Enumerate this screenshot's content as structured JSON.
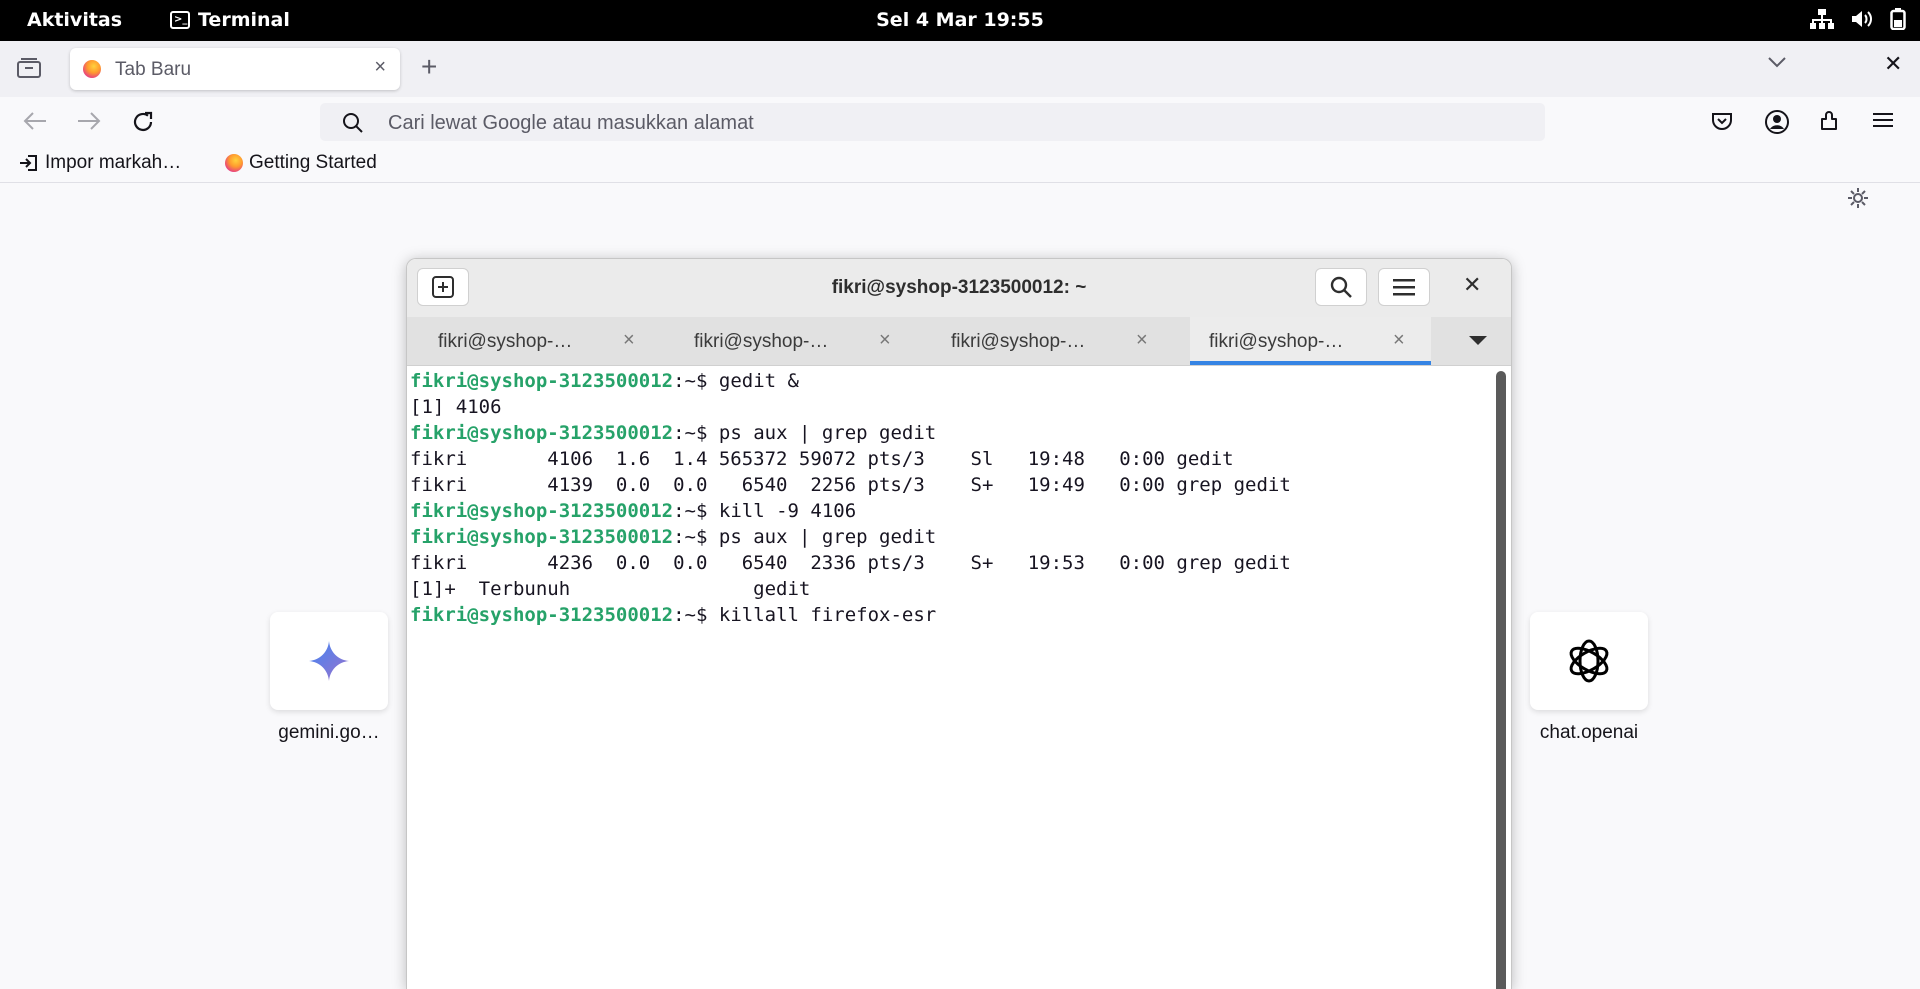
{
  "topbar": {
    "activities": "Aktivitas",
    "app_name": "Terminal",
    "clock": "Sel  4 Mar 19:55"
  },
  "browser": {
    "tab": {
      "title": "Tab Baru"
    },
    "search_placeholder": "Cari lewat Google atau masukkan alamat",
    "bookmarks": [
      "Impor markah…",
      "Getting Started"
    ],
    "shortcuts": [
      {
        "label": "gemini.go…",
        "icon": "gemini-sparkle-icon",
        "color": "#4285f4"
      },
      {
        "label": "chat.openai",
        "icon": "openai-logo-icon",
        "color": "#000000"
      }
    ]
  },
  "terminal": {
    "title": "fikri@syshop-3123500012: ~",
    "tabs": [
      {
        "label": "fikri@syshop-…",
        "active": false
      },
      {
        "label": "fikri@syshop-…",
        "active": false
      },
      {
        "label": "fikri@syshop-…",
        "active": false
      },
      {
        "label": "fikri@syshop-…",
        "active": true
      }
    ],
    "prompt": "fikri@syshop-3123500012",
    "prompt_suffix": ":~$ ",
    "lines": [
      {
        "type": "cmd",
        "text": "gedit &"
      },
      {
        "type": "out",
        "text": "[1] 4106"
      },
      {
        "type": "cmd",
        "text": "ps aux | grep gedit"
      },
      {
        "type": "out",
        "text": "fikri       4106  1.6  1.4 565372 59072 pts/3    Sl   19:48   0:00 gedit"
      },
      {
        "type": "out",
        "text": "fikri       4139  0.0  0.0   6540  2256 pts/3    S+   19:49   0:00 grep gedit"
      },
      {
        "type": "cmd",
        "text": "kill -9 4106"
      },
      {
        "type": "cmd",
        "text": "ps aux | grep gedit"
      },
      {
        "type": "out",
        "text": "fikri       4236  0.0  0.0   6540  2336 pts/3    S+   19:53   0:00 grep gedit"
      },
      {
        "type": "out",
        "text": "[1]+  Terbunuh                gedit"
      },
      {
        "type": "cmd",
        "text": "killall firefox-esr"
      }
    ],
    "colors": {
      "prompt": "#26a269",
      "accent": "#3584e4"
    }
  }
}
